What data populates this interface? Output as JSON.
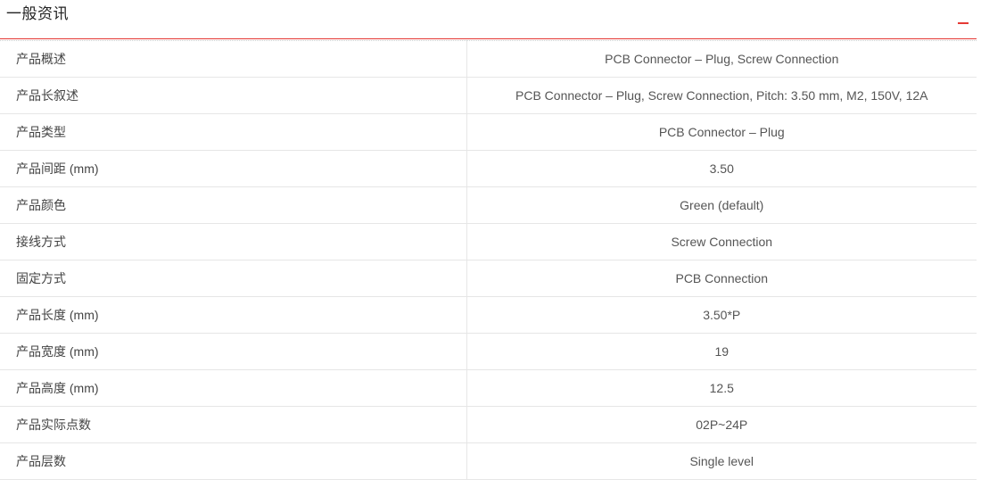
{
  "section": {
    "title": "一般资讯",
    "collapse_icon": "minus-icon",
    "accent_color": "#e53935"
  },
  "specs": [
    {
      "label": "产品概述",
      "value": "PCB Connector – Plug, Screw Connection"
    },
    {
      "label": "产品长叙述",
      "value": "PCB Connector – Plug, Screw Connection, Pitch: 3.50 mm, M2, 150V, 12A"
    },
    {
      "label": "产品类型",
      "value": "PCB Connector – Plug"
    },
    {
      "label": "产品间距 (mm)",
      "value": "3.50"
    },
    {
      "label": "产品颜色",
      "value": "Green (default)"
    },
    {
      "label": "接线方式",
      "value": "Screw Connection"
    },
    {
      "label": "固定方式",
      "value": "PCB Connection"
    },
    {
      "label": "产品长度 (mm)",
      "value": "3.50*P"
    },
    {
      "label": "产品宽度 (mm)",
      "value": "19"
    },
    {
      "label": "产品高度 (mm)",
      "value": "12.5"
    },
    {
      "label": "产品实际点数",
      "value": "02P~24P"
    },
    {
      "label": "产品层数",
      "value": "Single level"
    }
  ]
}
